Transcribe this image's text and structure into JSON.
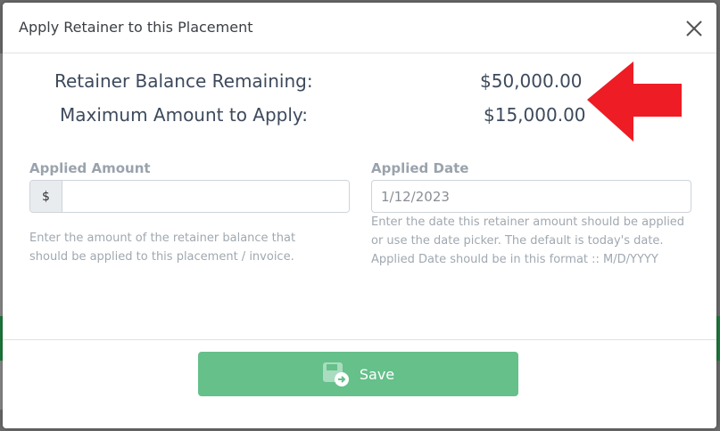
{
  "modal": {
    "title": "Apply Retainer to this Placement"
  },
  "summary": {
    "balance_label": "Retainer Balance Remaining:",
    "balance_value": "$50,000.00",
    "max_label": "Maximum Amount to Apply:",
    "max_value": "$15,000.00"
  },
  "applied_amount": {
    "label": "Applied Amount",
    "prefix": "$",
    "value": "",
    "help": "Enter the amount of the retainer balance that should be applied to this placement / invoice."
  },
  "applied_date": {
    "label": "Applied Date",
    "value": "1/12/2023",
    "help": "Enter the date this retainer amount should be applied or use the date picker. The default is today's date. Applied Date should be in this format :: M/D/YYYY"
  },
  "footer": {
    "save_label": "Save"
  },
  "colors": {
    "save_button": "#65c08a",
    "annotation_arrow": "#ee1c24"
  },
  "icons": {
    "close": "close-icon",
    "save": "save-icon",
    "annotation": "red-arrow-icon"
  }
}
